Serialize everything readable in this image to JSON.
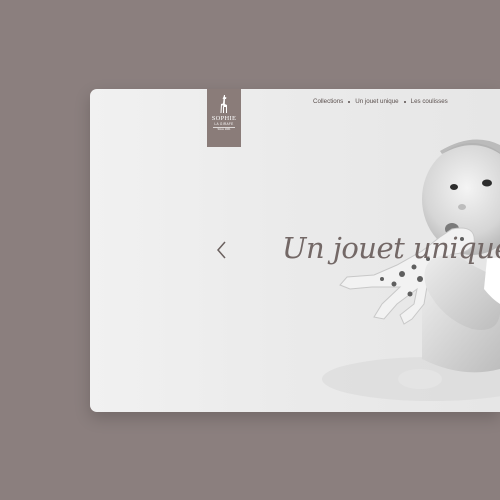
{
  "logo": {
    "brand": "SOPHIE",
    "sub": "LA GIRAFE",
    "since": "Since 1961",
    "icon": "giraffe-icon",
    "color": "#8a7c79"
  },
  "nav": {
    "items": [
      {
        "label": "Collections"
      },
      {
        "label": "Un jouet unique"
      },
      {
        "label": "Les coulisses"
      }
    ]
  },
  "hero": {
    "headline": "Un jouet unique",
    "prev_icon": "chevron-left-icon",
    "image": "baby-with-giraffe-toy"
  },
  "colors": {
    "background": "#8b7f7e",
    "text": "#5a4f4d",
    "headline": "#736866"
  }
}
